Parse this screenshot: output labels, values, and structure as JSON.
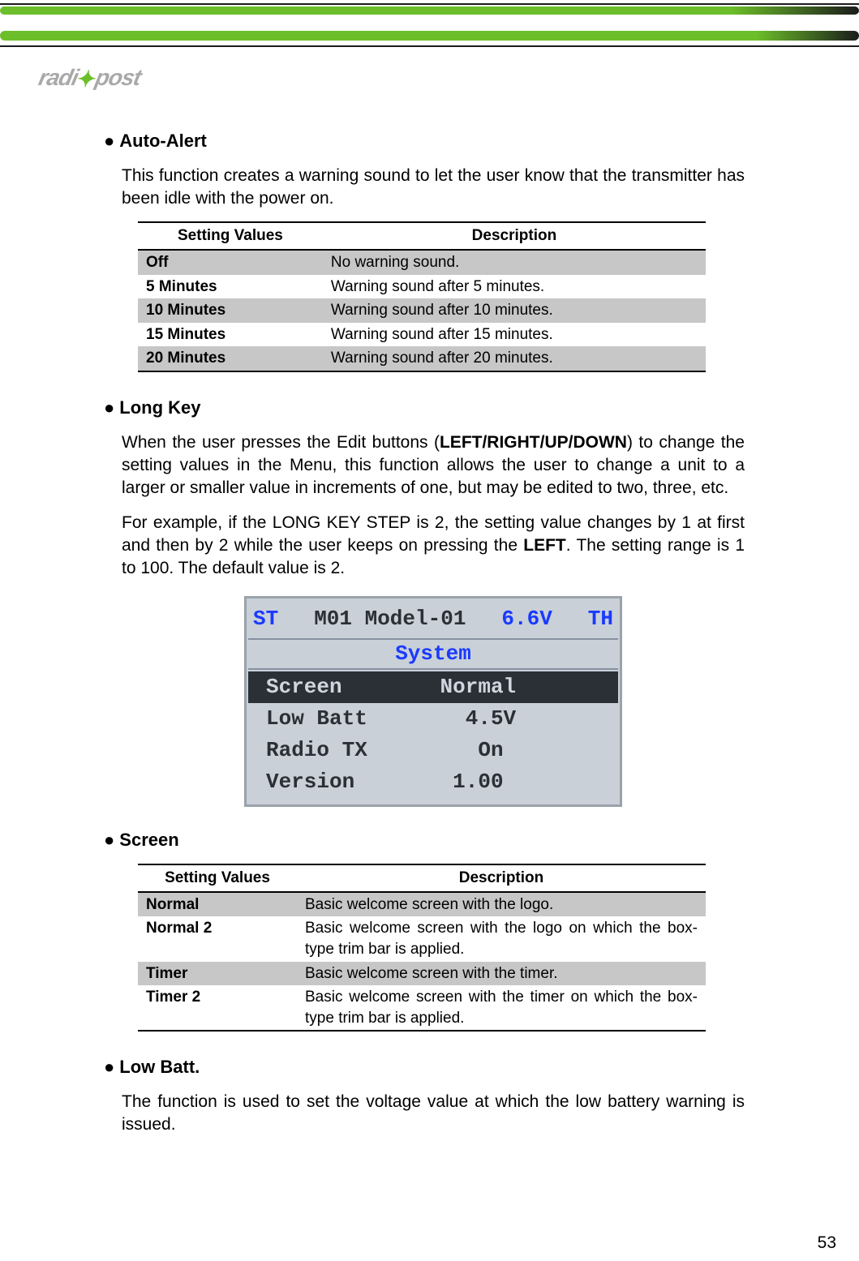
{
  "page_number": "53",
  "logo_text": "radi",
  "logo_text_after": "post",
  "sections": {
    "auto_alert": {
      "title": "Auto-Alert",
      "body": "This function creates a warning sound to let the user know that the transmitter has been idle with the power on.",
      "table": {
        "headers": [
          "Setting Values",
          "Description"
        ],
        "rows": [
          {
            "value": "Off",
            "desc": "No warning sound."
          },
          {
            "value": "5 Minutes",
            "desc": "Warning sound after 5 minutes."
          },
          {
            "value": "10 Minutes",
            "desc": "Warning sound after 10 minutes."
          },
          {
            "value": "15 Minutes",
            "desc": "Warning sound after 15 minutes."
          },
          {
            "value": "20 Minutes",
            "desc": "Warning sound after 20 minutes."
          }
        ]
      }
    },
    "long_key": {
      "title": "Long Key",
      "body_1_pre": "When the user presses the Edit buttons (",
      "buttons": "LEFT/RIGHT/UP/DOWN",
      "body_1_post": ") to change the setting values in the Menu, this function allows the user to change a unit to a larger or smaller value in increments of one, but may be edited to two, three, etc.",
      "body_2_pre": "For example, if the LONG KEY STEP is 2, the setting value changes by 1 at first and then by 2 while the user keeps on pressing the ",
      "body_2_bold": "LEFT",
      "body_2_post": ". The setting range is 1 to 100.  The default value is 2."
    },
    "lcd": {
      "st": "ST",
      "mid": "M01 Model-01",
      "volt": "6.6V",
      "th": "TH",
      "title": "System",
      "rows": [
        {
          "l": "Screen",
          "r": "Normal",
          "selected": true
        },
        {
          "l": "Low Batt",
          "r": "  4.5V",
          "selected": false
        },
        {
          "l": "Radio TX",
          "r": "   On",
          "selected": false
        },
        {
          "l": "Version",
          "r": " 1.00",
          "selected": false
        }
      ]
    },
    "screen": {
      "title": "Screen",
      "table": {
        "headers": [
          "Setting Values",
          "Description"
        ],
        "rows": [
          {
            "value": "Normal",
            "desc": "Basic welcome screen with the logo."
          },
          {
            "value": "Normal 2",
            "desc": "Basic welcome screen with the logo on which the box-type trim bar is applied."
          },
          {
            "value": "Timer",
            "desc": "Basic welcome screen with the timer."
          },
          {
            "value": "Timer 2",
            "desc": "Basic welcome screen with the timer on which the box-type trim bar is applied."
          }
        ]
      }
    },
    "low_batt": {
      "title": "Low Batt.",
      "body": "The function is used to set the voltage value at which the low battery warning is issued."
    }
  }
}
